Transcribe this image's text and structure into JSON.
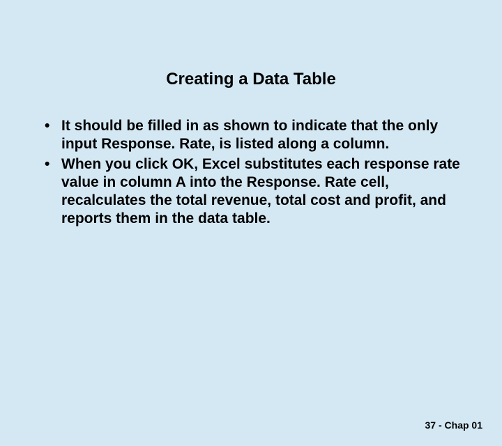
{
  "slide": {
    "title": "Creating a Data Table",
    "bullets": [
      "It should be filled in as shown to indicate that the only input Response. Rate, is listed along a column.",
      "When you click OK, Excel substitutes each response rate value in column A into the Response. Rate cell, recalculates the total revenue, total cost and profit, and reports them in the data table."
    ],
    "footer": "37 - Chap 01"
  }
}
